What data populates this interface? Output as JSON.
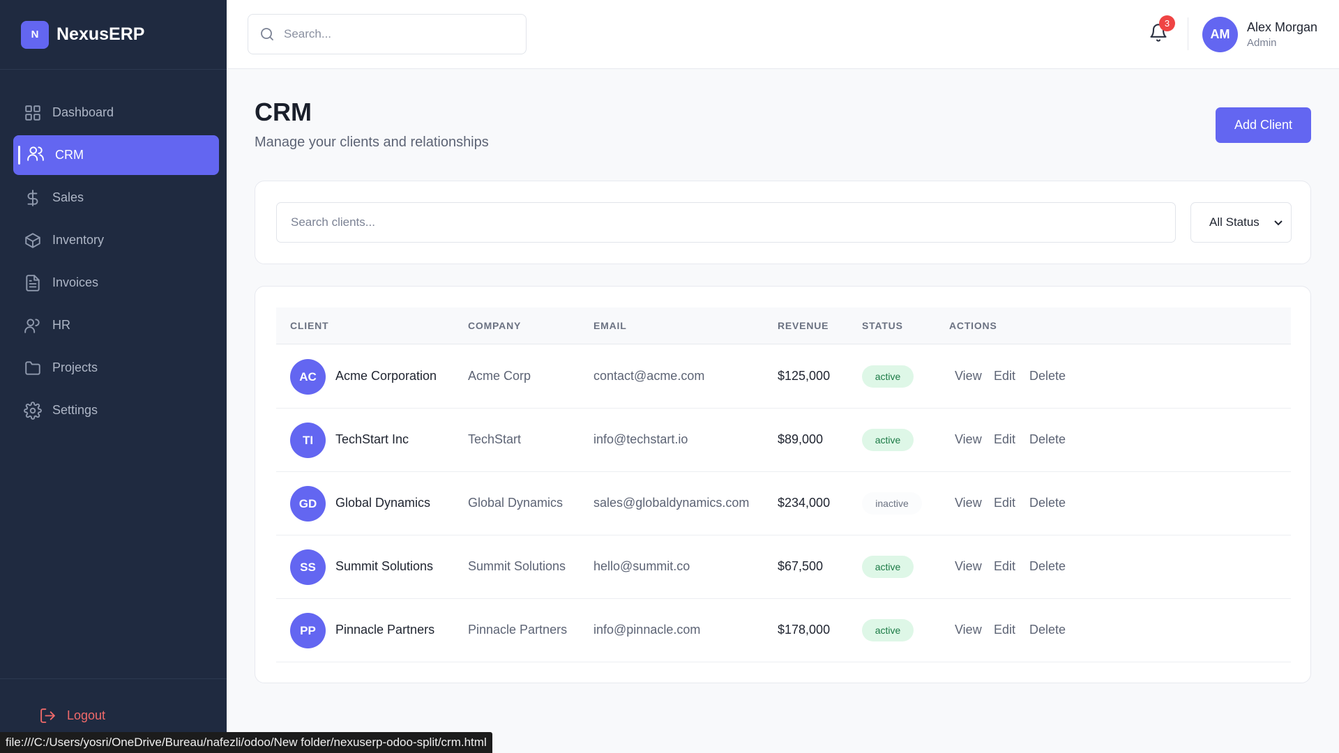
{
  "brand": {
    "logo_letter": "N",
    "name": "NexusERP"
  },
  "sidebar": {
    "items": [
      {
        "label": "Dashboard",
        "icon": "grid-icon",
        "active": false
      },
      {
        "label": "CRM",
        "icon": "users-icon",
        "active": true
      },
      {
        "label": "Sales",
        "icon": "dollar-icon",
        "active": false
      },
      {
        "label": "Inventory",
        "icon": "box-icon",
        "active": false
      },
      {
        "label": "Invoices",
        "icon": "file-icon",
        "active": false
      },
      {
        "label": "HR",
        "icon": "user-icon",
        "active": false
      },
      {
        "label": "Projects",
        "icon": "folder-icon",
        "active": false
      },
      {
        "label": "Settings",
        "icon": "gear-icon",
        "active": false
      }
    ],
    "logout_label": "Logout"
  },
  "topbar": {
    "search_placeholder": "Search...",
    "notification_count": "3",
    "user": {
      "initials": "AM",
      "name": "Alex Morgan",
      "role": "Admin"
    }
  },
  "page": {
    "title": "CRM",
    "subtitle": "Manage your clients and relationships",
    "add_button": "Add Client"
  },
  "filters": {
    "search_placeholder": "Search clients...",
    "status_selected": "All Status"
  },
  "table": {
    "columns": [
      "CLIENT",
      "COMPANY",
      "EMAIL",
      "REVENUE",
      "STATUS",
      "ACTIONS"
    ],
    "actions": [
      "View",
      "Edit",
      "Delete"
    ],
    "rows": [
      {
        "initials": "AC",
        "client": "Acme Corporation",
        "company": "Acme Corp",
        "email": "contact@acme.com",
        "revenue": "$125,000",
        "status": "active"
      },
      {
        "initials": "TI",
        "client": "TechStart Inc",
        "company": "TechStart",
        "email": "info@techstart.io",
        "revenue": "$89,000",
        "status": "active"
      },
      {
        "initials": "GD",
        "client": "Global Dynamics",
        "company": "Global Dynamics",
        "email": "sales@globaldynamics.com",
        "revenue": "$234,000",
        "status": "inactive"
      },
      {
        "initials": "SS",
        "client": "Summit Solutions",
        "company": "Summit Solutions",
        "email": "hello@summit.co",
        "revenue": "$67,500",
        "status": "active"
      },
      {
        "initials": "PP",
        "client": "Pinnacle Partners",
        "company": "Pinnacle Partners",
        "email": "info@pinnacle.com",
        "revenue": "$178,000",
        "status": "active"
      }
    ]
  },
  "browser": {
    "status_url": "file:///C:/Users/yosri/OneDrive/Bureau/nafezli/odoo/New folder/nexuserp-odoo-split/crm.html"
  },
  "colors": {
    "accent": "#6366f1",
    "sidebar_bg": "#1f2a40",
    "active_badge_bg": "#def7e7",
    "danger": "#ef4444"
  }
}
